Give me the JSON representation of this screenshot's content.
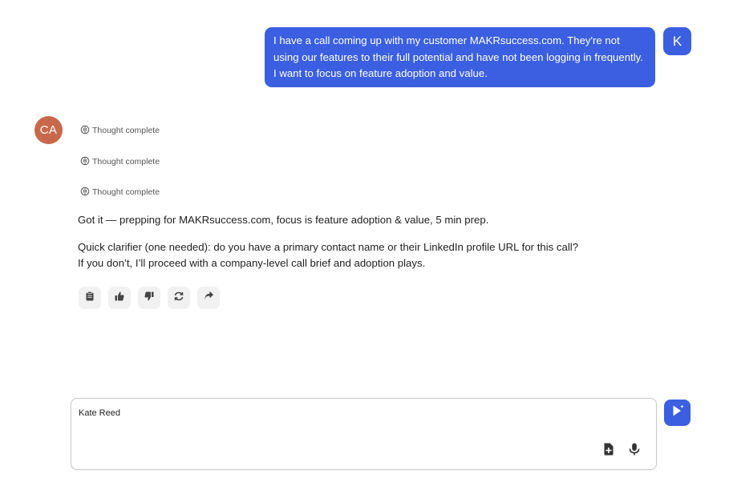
{
  "user_message": {
    "avatar_initial": "K",
    "text": "I have a call coming up with my customer MAKRsuccess.com. They're not using our features to their full potential and have not been logging in frequently. I want to focus on feature adoption and value."
  },
  "assistant": {
    "avatar_initials": "CA",
    "thoughts": [
      "Thought complete",
      "Thought complete",
      "Thought complete"
    ],
    "paragraph_1": "Got it — prepping for MAKRsuccess.com, focus is feature adoption & value, 5 min prep.",
    "paragraph_2": "Quick clarifier (one needed): do you have a primary contact name or their LinkedIn profile URL for this call? If you don’t, I’ll proceed with a company-level call brief and adoption plays.",
    "actions": [
      "clipboard-icon",
      "thumbs-up-icon",
      "thumbs-down-icon",
      "regenerate-icon",
      "share-icon"
    ]
  },
  "composer": {
    "value": "Kate Reed"
  },
  "colors": {
    "accent": "#3b5fe0",
    "assistant_avatar": "#c8684a"
  }
}
